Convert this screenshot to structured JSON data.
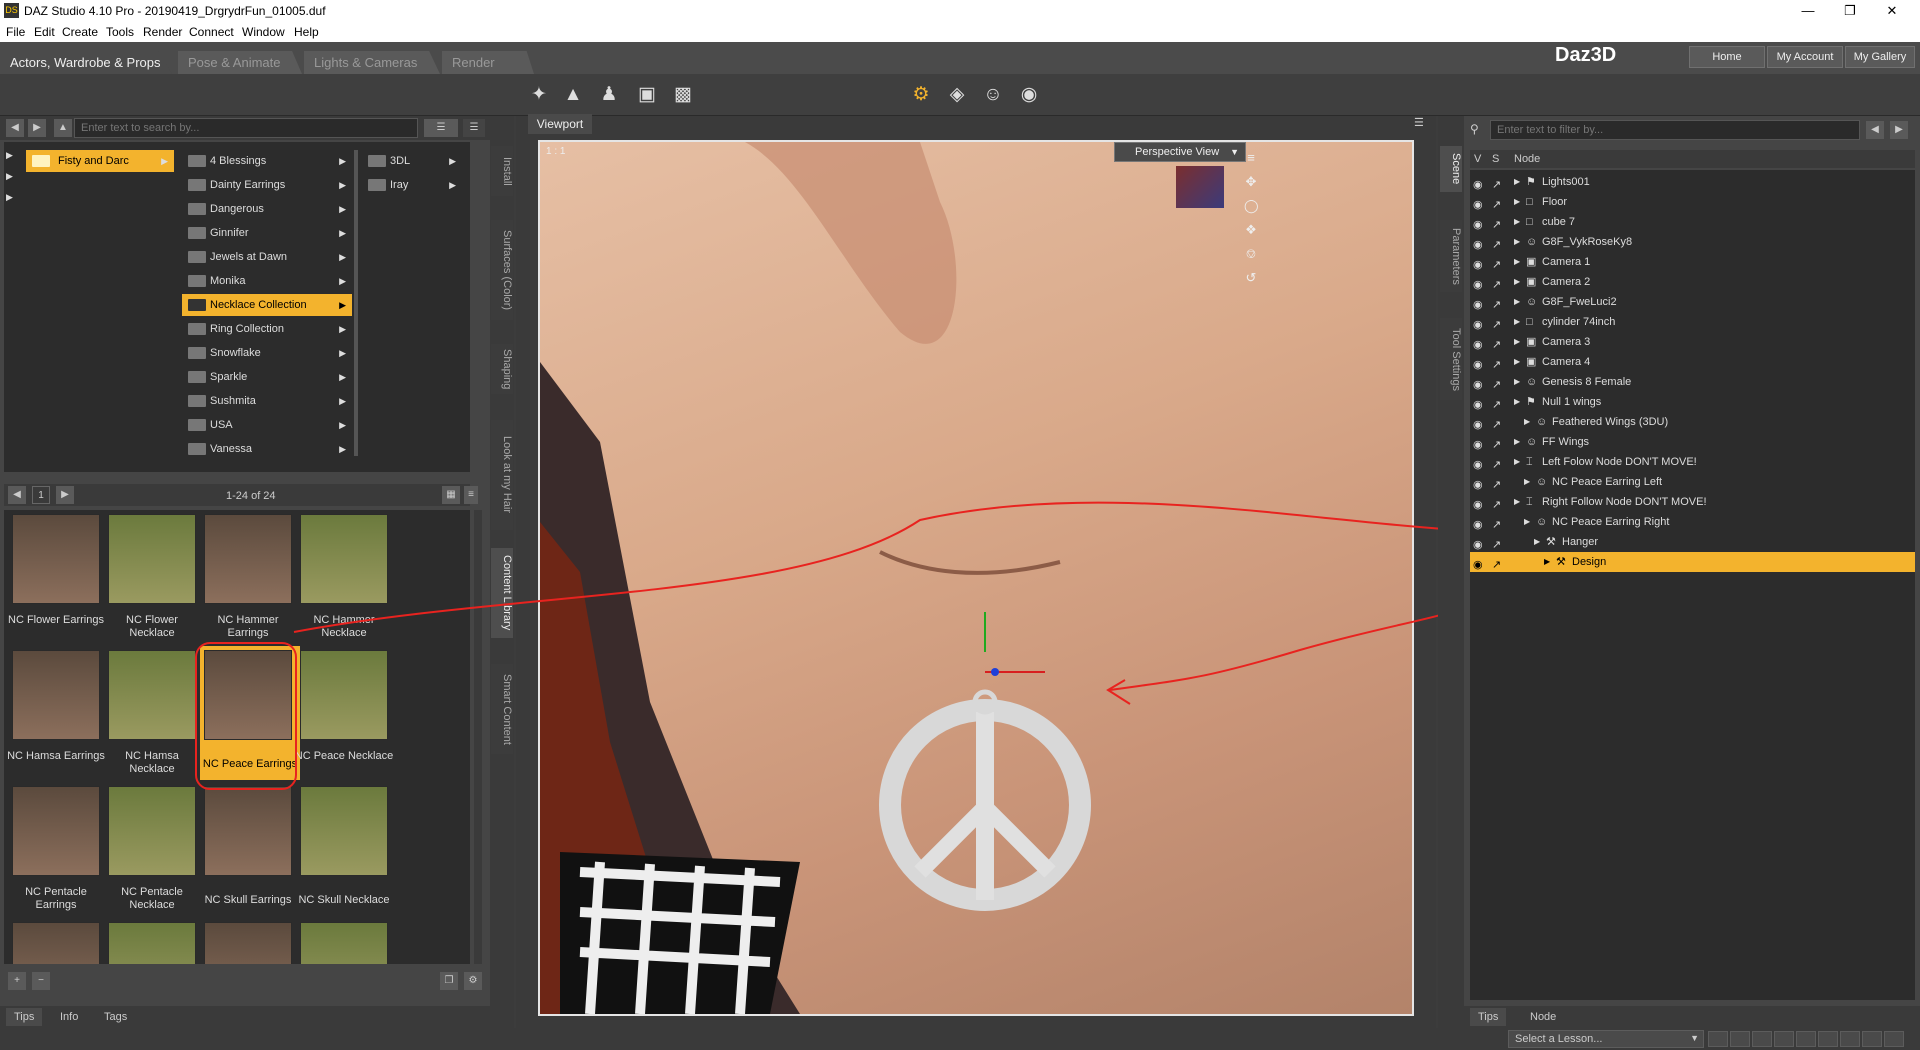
{
  "window": {
    "title": "DAZ Studio 4.10 Pro - 20190419_DrgrydrFun_01005.duf",
    "app_icon_text": "DS"
  },
  "menu": [
    "File",
    "Edit",
    "Create",
    "Tools",
    "Render",
    "Connect",
    "Window",
    "Help"
  ],
  "room_tabs": [
    "Actors, Wardrobe & Props",
    "Pose & Animate",
    "Lights & Cameras",
    "Render"
  ],
  "brand": {
    "logo": "Daz3D",
    "buttons": [
      "Home",
      "My Account",
      "My Gallery"
    ]
  },
  "content_library": {
    "search_placeholder": "Enter text to search by...",
    "col1": [
      {
        "label": "Fisty and Darc",
        "selected": true
      }
    ],
    "col2": [
      {
        "label": "4 Blessings"
      },
      {
        "label": "Dainty Earrings"
      },
      {
        "label": "Dangerous"
      },
      {
        "label": "Ginnifer"
      },
      {
        "label": "Jewels at Dawn"
      },
      {
        "label": "Monika"
      },
      {
        "label": "Necklace Collection",
        "selected": true
      },
      {
        "label": "Ring Collection"
      },
      {
        "label": "Snowflake"
      },
      {
        "label": "Sparkle"
      },
      {
        "label": "Sushmita"
      },
      {
        "label": "USA"
      },
      {
        "label": "Vanessa"
      }
    ],
    "col3": [
      {
        "label": "3DL"
      },
      {
        "label": "Iray"
      }
    ],
    "page": "1",
    "range": "1-24 of 24",
    "thumbs": [
      {
        "label": "NC Flower Earrings"
      },
      {
        "label": "NC Flower Necklace"
      },
      {
        "label": "NC Hammer Earrings"
      },
      {
        "label": "NC Hammer Necklace"
      },
      {
        "label": "NC Hamsa Earrings"
      },
      {
        "label": "NC Hamsa Necklace"
      },
      {
        "label": "NC Peace Earrings",
        "selected": true
      },
      {
        "label": "NC Peace Necklace"
      },
      {
        "label": "NC Pentacle Earrings"
      },
      {
        "label": "NC Pentacle Necklace"
      },
      {
        "label": "NC Skull Earrings"
      },
      {
        "label": "NC Skull Necklace"
      }
    ],
    "bottom_tabs": [
      "Tips",
      "Info",
      "Tags"
    ],
    "side_tabs": [
      "Install",
      "Surfaces (Color)",
      "Shaping",
      "Look at my Hair",
      "Content Library",
      "Smart Content"
    ]
  },
  "viewport": {
    "tab": "Viewport",
    "ratio": "1 : 1",
    "view_select": "Perspective View"
  },
  "scene": {
    "filter_placeholder": "Enter text to filter by...",
    "col_v": "V",
    "col_s": "S",
    "col_node": "Node",
    "nodes": [
      {
        "label": "Lights001",
        "indent": 0,
        "icon": "⚑"
      },
      {
        "label": "Floor",
        "indent": 0,
        "icon": "□"
      },
      {
        "label": "cube 7",
        "indent": 0,
        "icon": "□"
      },
      {
        "label": "G8F_VykRoseKy8",
        "indent": 0,
        "icon": "☺"
      },
      {
        "label": "Camera 1",
        "indent": 0,
        "icon": "▣"
      },
      {
        "label": "Camera 2",
        "indent": 0,
        "icon": "▣"
      },
      {
        "label": "G8F_FweLuci2",
        "indent": 0,
        "icon": "☺"
      },
      {
        "label": "cylinder 74inch",
        "indent": 0,
        "icon": "□"
      },
      {
        "label": "Camera 3",
        "indent": 0,
        "icon": "▣"
      },
      {
        "label": "Camera 4",
        "indent": 0,
        "icon": "▣"
      },
      {
        "label": "Genesis 8 Female",
        "indent": 0,
        "icon": "☺"
      },
      {
        "label": "Null 1 wings",
        "indent": 0,
        "icon": "⚑"
      },
      {
        "label": "Feathered Wings (3DU)",
        "indent": 1,
        "icon": "☺"
      },
      {
        "label": "FF Wings",
        "indent": 0,
        "icon": "☺"
      },
      {
        "label": "Left Folow Node DON'T MOVE!",
        "indent": 0,
        "icon": "⌶"
      },
      {
        "label": "NC Peace Earring Left",
        "indent": 1,
        "icon": "☺"
      },
      {
        "label": "Right Follow Node DON'T MOVE!",
        "indent": 0,
        "icon": "⌶"
      },
      {
        "label": "NC Peace Earring Right",
        "indent": 1,
        "icon": "☺"
      },
      {
        "label": "Hanger",
        "indent": 2,
        "icon": "⚒"
      },
      {
        "label": "Design",
        "indent": 3,
        "icon": "⚒",
        "selected": true
      }
    ],
    "side_tabs": [
      "Scene",
      "Parameters",
      "Tool Settings"
    ],
    "bottom_tabs": [
      "Tips",
      "Node"
    ],
    "lesson_select": "Select a Lesson..."
  },
  "colors": {
    "accent": "#f3b32d",
    "annotation": "#e8231f"
  }
}
